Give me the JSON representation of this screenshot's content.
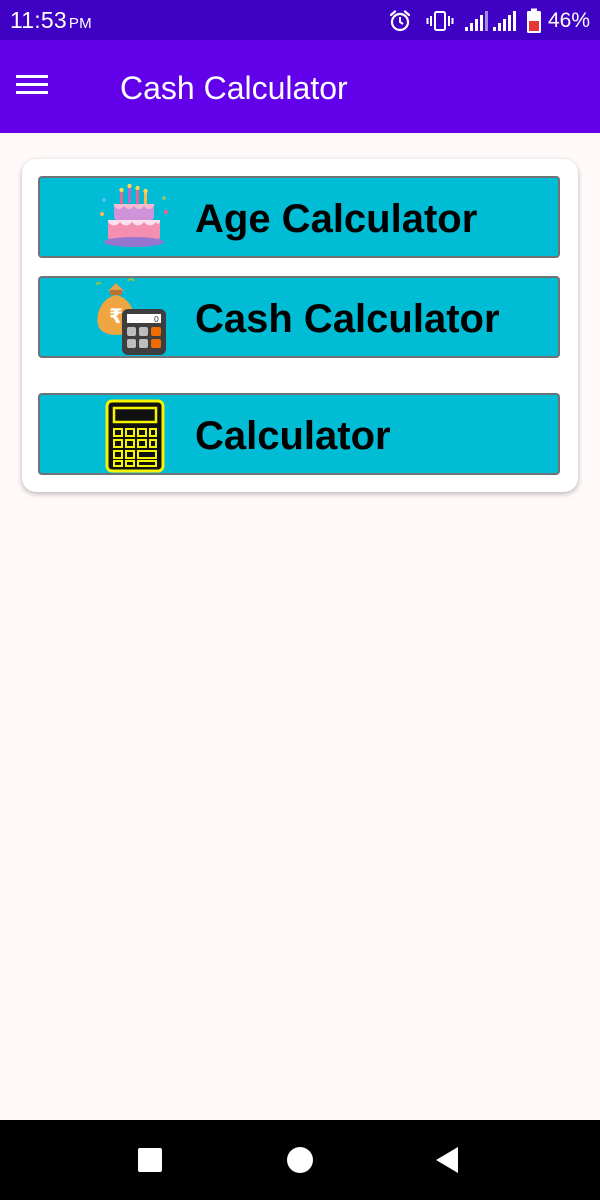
{
  "status_bar": {
    "time": "11:53",
    "ampm": "PM",
    "battery_percent": "46%",
    "icons": [
      "alarm-icon",
      "vibrate-icon",
      "signal-icon",
      "signal-icon",
      "battery-icon"
    ]
  },
  "app_bar": {
    "title": "Cash Calculator",
    "menu_icon": "hamburger-menu-icon"
  },
  "menu": {
    "items": [
      {
        "label": "Age Calculator",
        "icon": "birthday-cake-icon"
      },
      {
        "label": "Cash Calculator",
        "icon": "money-bag-calculator-icon"
      },
      {
        "label": "Calculator",
        "icon": "calculator-icon"
      }
    ]
  },
  "nav_bar": {
    "buttons": [
      "recents-square-icon",
      "home-circle-icon",
      "back-triangle-icon"
    ]
  },
  "colors": {
    "status_bar": "#3f02c4",
    "app_bar": "#6200ea",
    "button": "#00bcd4",
    "background": "#fffaf9"
  }
}
